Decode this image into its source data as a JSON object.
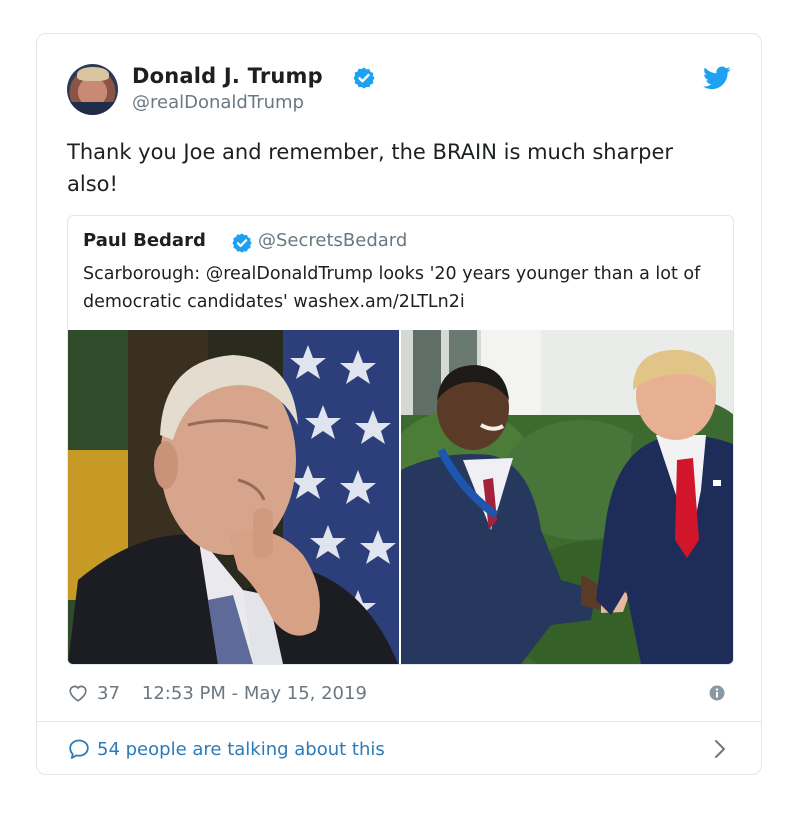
{
  "author": {
    "name": "Donald J. Trump",
    "handle": "@realDonaldTrump",
    "verified": true
  },
  "tweet": {
    "text": "Thank you Joe and remember, the BRAIN is much sharper also!"
  },
  "quoted_tweet": {
    "name": "Paul Bedard",
    "handle": "@SecretsBedard",
    "verified": true,
    "text": "Scarborough: @realDonaldTrump looks '20 years younger than a lot of democratic candidates' washex.am/2LTLn2i"
  },
  "meta": {
    "likes": "37",
    "timestamp": "12:53 PM - May 15, 2019"
  },
  "footer": {
    "talking": "54 people are talking about this"
  },
  "icons": {
    "verified": "verified-badge-icon",
    "bird": "twitter-bird-icon",
    "heart": "heart-icon",
    "info": "info-icon",
    "reply": "speech-bubble-icon",
    "chevron": "chevron-right-icon"
  },
  "colors": {
    "accent": "#1da1f2",
    "link": "#2b7bb9",
    "muted": "#697882",
    "border": "#e1e8ed"
  }
}
